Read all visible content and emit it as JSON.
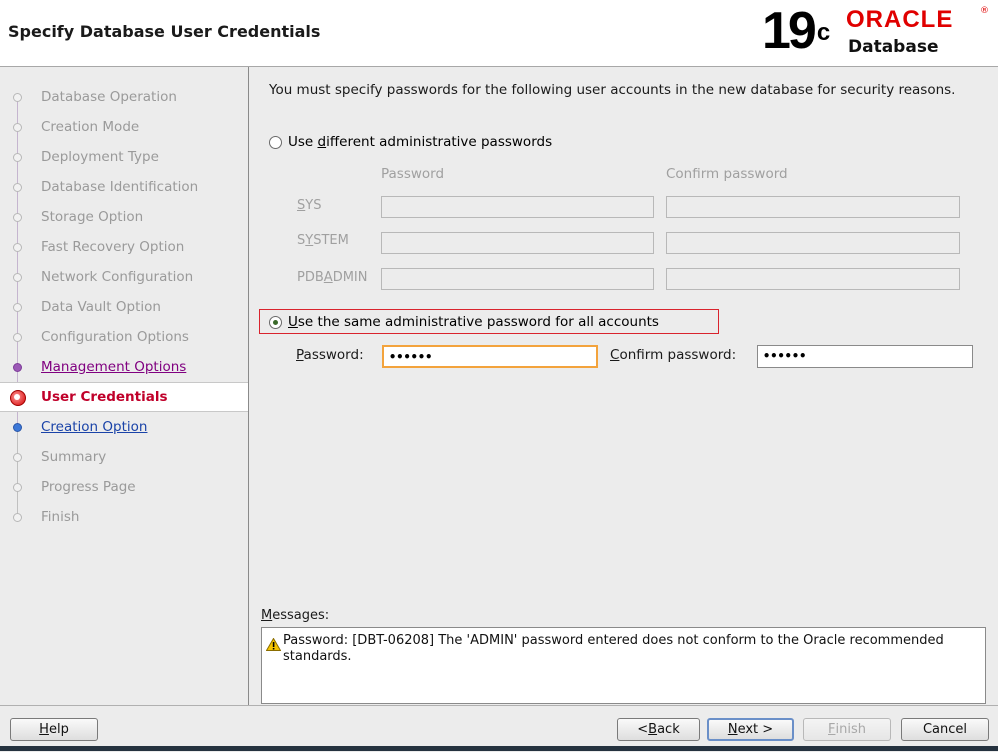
{
  "header": {
    "title": "Specify Database User Credentials",
    "logo": {
      "version": "19",
      "version_sup": "c",
      "brand": "ORACLE",
      "reg": "®",
      "product": "Database"
    }
  },
  "sidebar": {
    "items": [
      {
        "label": "Database Operation",
        "state": "disabled"
      },
      {
        "label": "Creation Mode",
        "state": "disabled"
      },
      {
        "label": "Deployment Type",
        "state": "disabled"
      },
      {
        "label": "Database Identification",
        "state": "disabled"
      },
      {
        "label": "Storage Option",
        "state": "disabled"
      },
      {
        "label": "Fast Recovery Option",
        "state": "disabled"
      },
      {
        "label": "Network Configuration",
        "state": "disabled"
      },
      {
        "label": "Data Vault Option",
        "state": "disabled"
      },
      {
        "label": "Configuration Options",
        "state": "disabled"
      },
      {
        "label": "Management Options",
        "state": "visited"
      },
      {
        "label": "User Credentials",
        "state": "current"
      },
      {
        "label": "Creation Option",
        "state": "next"
      },
      {
        "label": "Summary",
        "state": "disabled"
      },
      {
        "label": "Progress Page",
        "state": "disabled"
      },
      {
        "label": "Finish",
        "state": "disabled"
      }
    ]
  },
  "main": {
    "intro": "You must specify passwords for the following user accounts in the new database for security reasons.",
    "option_different": {
      "pre": "Use ",
      "mnemonic": "d",
      "post": "ifferent administrative passwords",
      "checked": false
    },
    "grid": {
      "col_password": "Password",
      "col_confirm": "Confirm password",
      "rows": [
        {
          "pre": "",
          "mnemonic": "S",
          "post": "YS"
        },
        {
          "pre": "S",
          "mnemonic": "Y",
          "post": "STEM"
        },
        {
          "pre": "PDB",
          "mnemonic": "A",
          "post": "DMIN"
        }
      ]
    },
    "option_same": {
      "pre": "",
      "mnemonic": "U",
      "post": "se the same administrative password for all accounts",
      "checked": true
    },
    "password": {
      "mnemonic": "P",
      "rest": "assword:",
      "value": "••••••"
    },
    "confirm": {
      "mnemonic": "C",
      "rest": "onfirm password:",
      "value": "••••••"
    },
    "messages": {
      "label_mnemonic": "M",
      "label_rest": "essages:",
      "text": "Password: [DBT-06208] The 'ADMIN' password entered does not conform to the Oracle recommended standards."
    }
  },
  "footer": {
    "help": {
      "mnemonic": "H",
      "rest": "elp"
    },
    "back": {
      "pre": "< ",
      "mnemonic": "B",
      "rest": "ack"
    },
    "next": {
      "mnemonic": "N",
      "rest": "ext >"
    },
    "finish": {
      "mnemonic": "F",
      "rest": "inish"
    },
    "cancel": "Cancel"
  },
  "colors": {
    "accent_red": "#d9232d",
    "focus_orange": "#f3a33c",
    "oracle_red": "#e00000"
  }
}
